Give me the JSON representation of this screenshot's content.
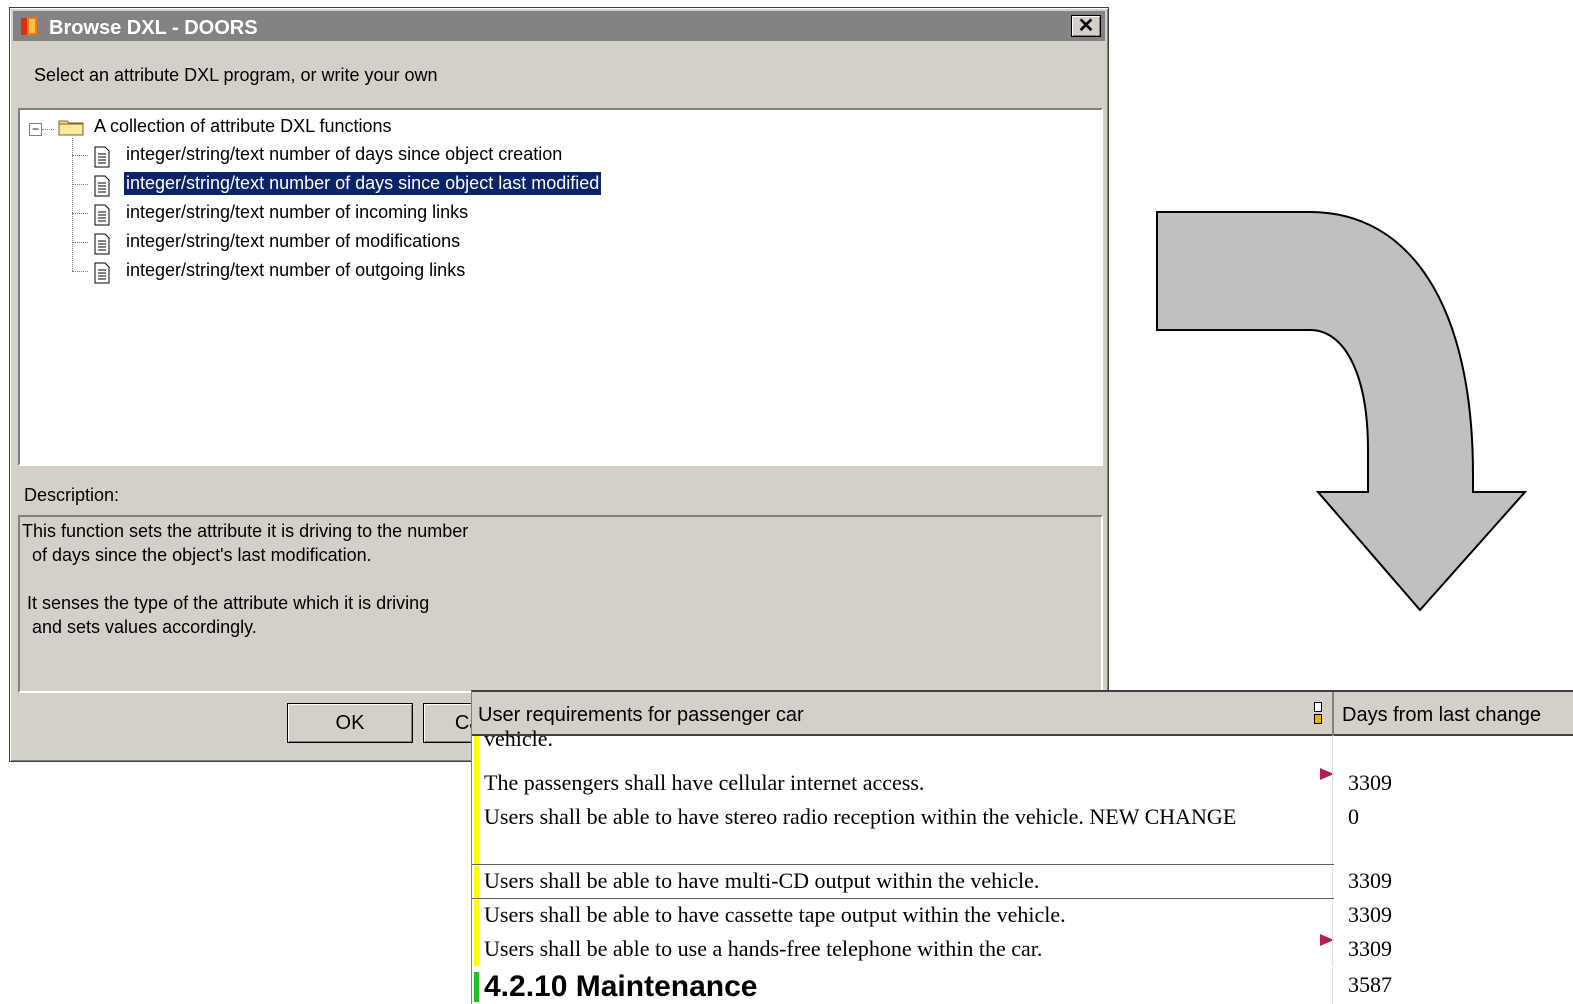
{
  "dialog": {
    "title": "Browse DXL - DOORS",
    "close_glyph": "✕",
    "prompt": "Select an attribute DXL program, or write your own",
    "tree": {
      "root": {
        "label": "A collection of attribute DXL functions",
        "expander": "−"
      },
      "items": [
        {
          "label": "integer/string/text number of days since object creation",
          "selected": false
        },
        {
          "label": "integer/string/text number of days since object last modified",
          "selected": true
        },
        {
          "label": "integer/string/text number of incoming links",
          "selected": false
        },
        {
          "label": "integer/string/text number of modifications",
          "selected": false
        },
        {
          "label": "integer/string/text number of outgoing links",
          "selected": false
        }
      ]
    },
    "description_label": "Description:",
    "description_lines": [
      "This function sets the attribute it is driving to the number",
      "  of days since the object's last modification.",
      "",
      " It senses the type of the attribute which it is driving",
      "  and sets values accordingly."
    ],
    "ok_label": "OK",
    "cancel_label": "Cancel"
  },
  "module": {
    "col1_header": "User requirements for passenger car",
    "col2_header": "Days from last change",
    "rows": [
      {
        "text": "vehicle.",
        "value": "",
        "bar_color": "#ffff00",
        "flag": false
      },
      {
        "text": "The passengers shall have cellular internet access.",
        "value": "3309",
        "bar_color": "#ffff00",
        "flag": true
      },
      {
        "text": "Users shall be able to have stereo radio reception within the vehicle. NEW CHANGE",
        "value": "0",
        "bar_color": "#ffff00",
        "flag": false
      },
      {
        "text": "Users shall be able to have multi-CD output within the vehicle.",
        "value": "3309",
        "bar_color": "#ffff00",
        "flag": false
      },
      {
        "text": "Users shall be able to have cassette tape output within the vehicle.",
        "value": "3309",
        "bar_color": "#ffff00",
        "flag": false
      },
      {
        "text": "Users shall be able to use a hands-free telephone within the car.",
        "value": "3309",
        "bar_color": "#ffff00",
        "flag": true
      },
      {
        "text": "4.2.10 Maintenance",
        "value": "3587",
        "bar_color": "#22c022",
        "flag": false,
        "heading": true
      }
    ]
  },
  "colors": {
    "titlebar": "#848284",
    "selection": "#0a246a",
    "flag": "#b0205a",
    "arrow_fill": "#c0c0c0"
  }
}
